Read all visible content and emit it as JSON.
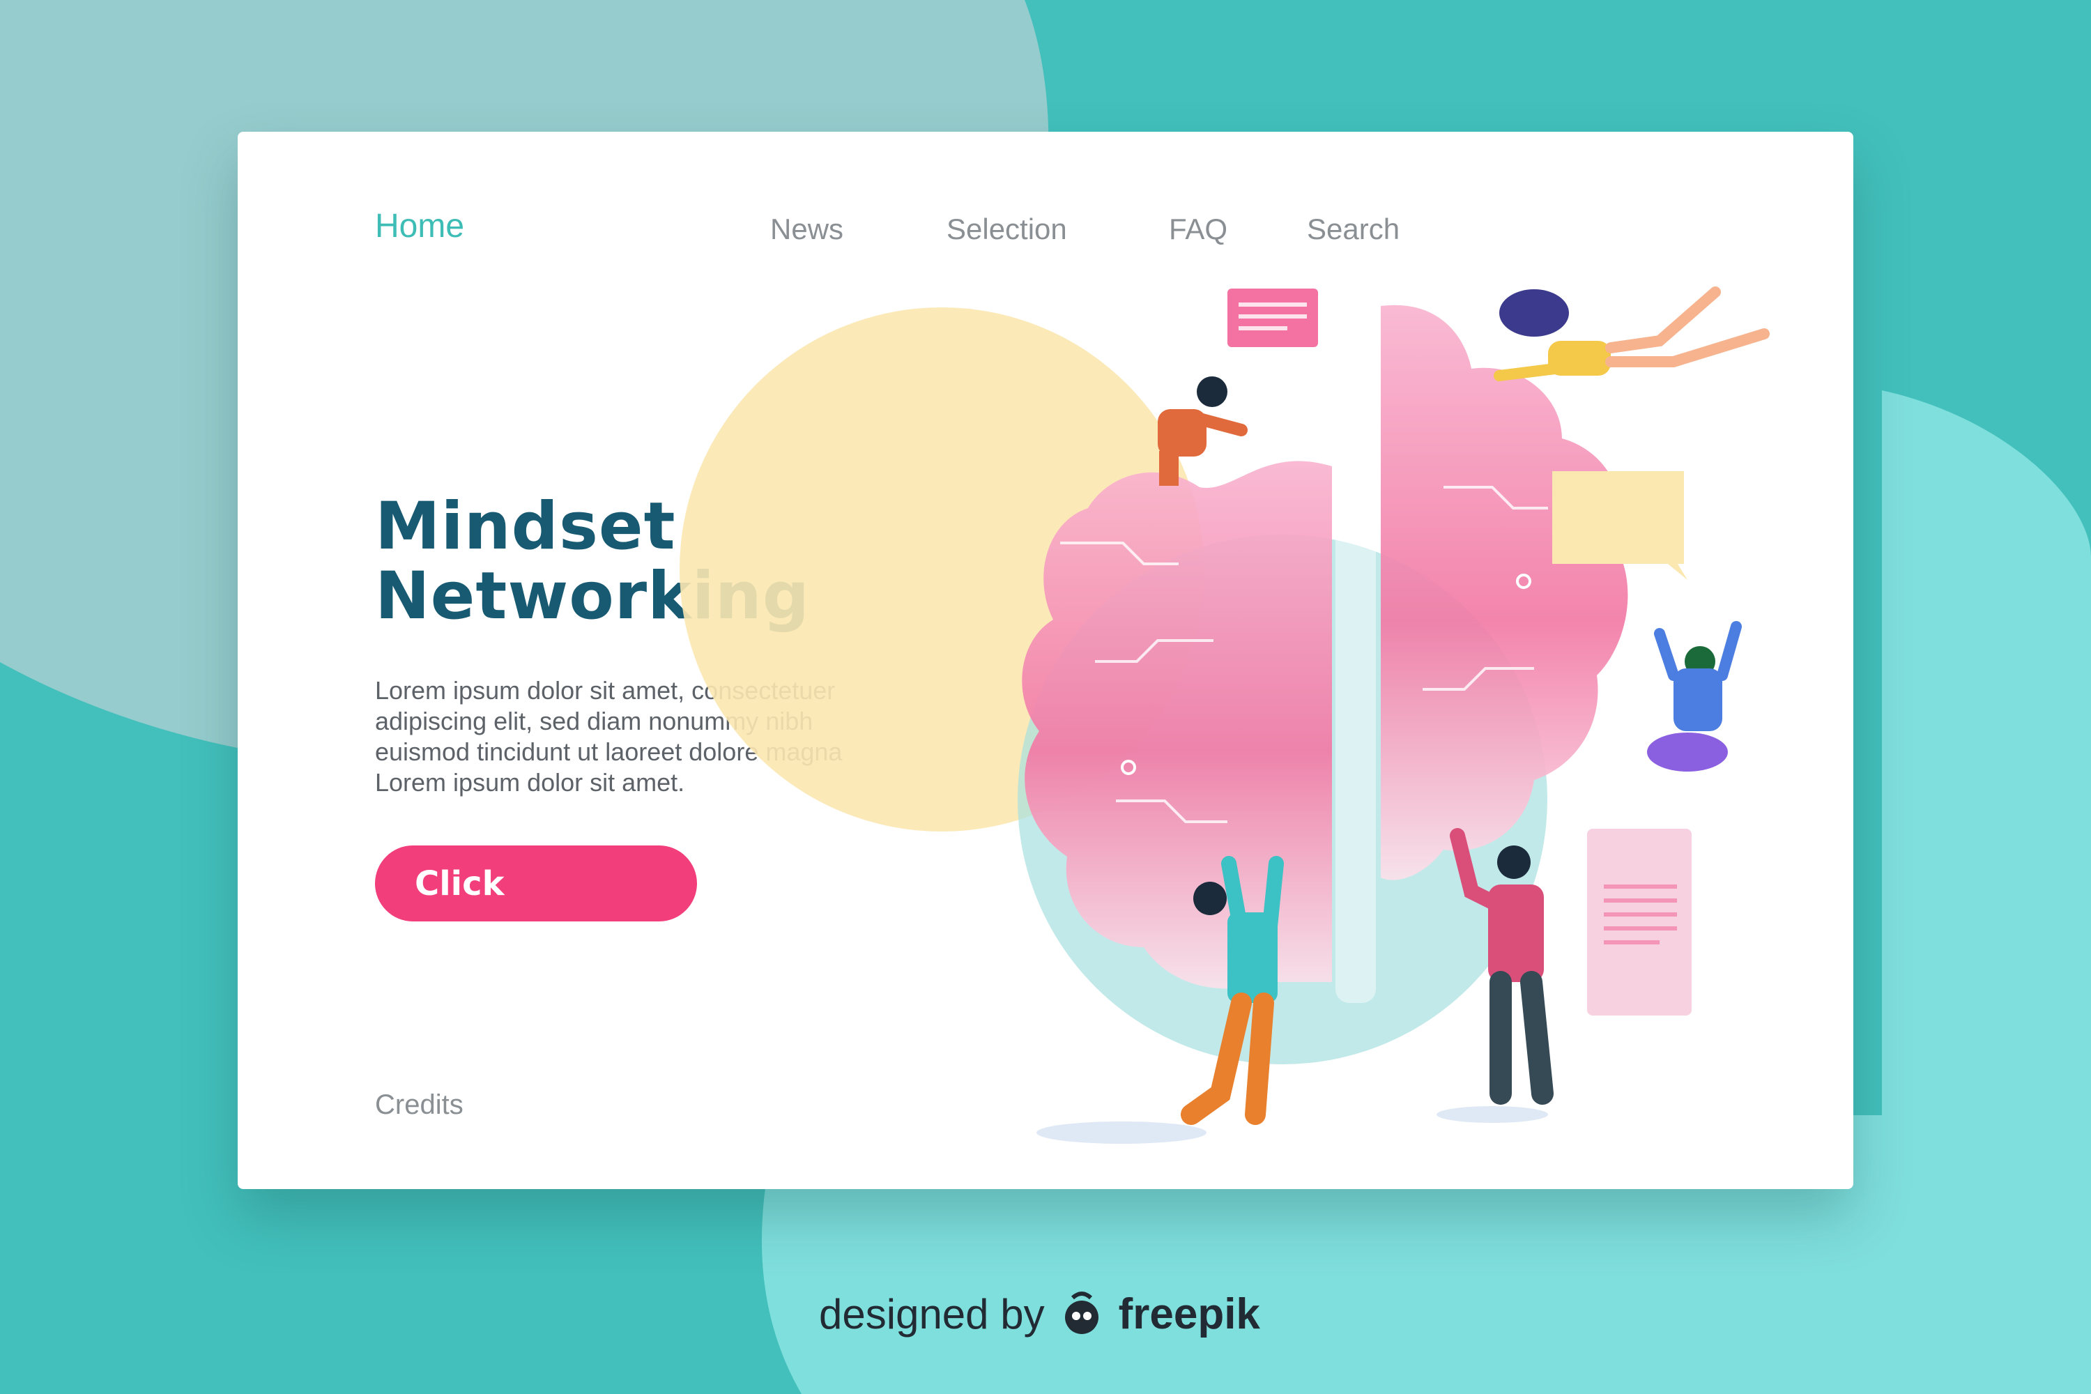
{
  "nav": {
    "home": "Home",
    "items": [
      "News",
      "Selection",
      "FAQ",
      "Search"
    ]
  },
  "hero": {
    "title_line1": "Mindset",
    "title_line2": "Networking",
    "body_lines": [
      "Lorem ipsum dolor sit amet, consectetuer",
      "adipiscing elit, sed diam nonummy nibh",
      "euismod tincidunt ut laoreet dolore magna",
      "Lorem ipsum dolor sit amet."
    ],
    "button_label": "Click"
  },
  "footer": {
    "credits": "Credits"
  },
  "brand": {
    "prefix": "designed by",
    "name": "freepik"
  },
  "colors": {
    "accent": "#3dbdb5",
    "title": "#175a72",
    "button": "#f23e7a",
    "background": "#4cc4c0",
    "brain": "#f48ab0"
  }
}
